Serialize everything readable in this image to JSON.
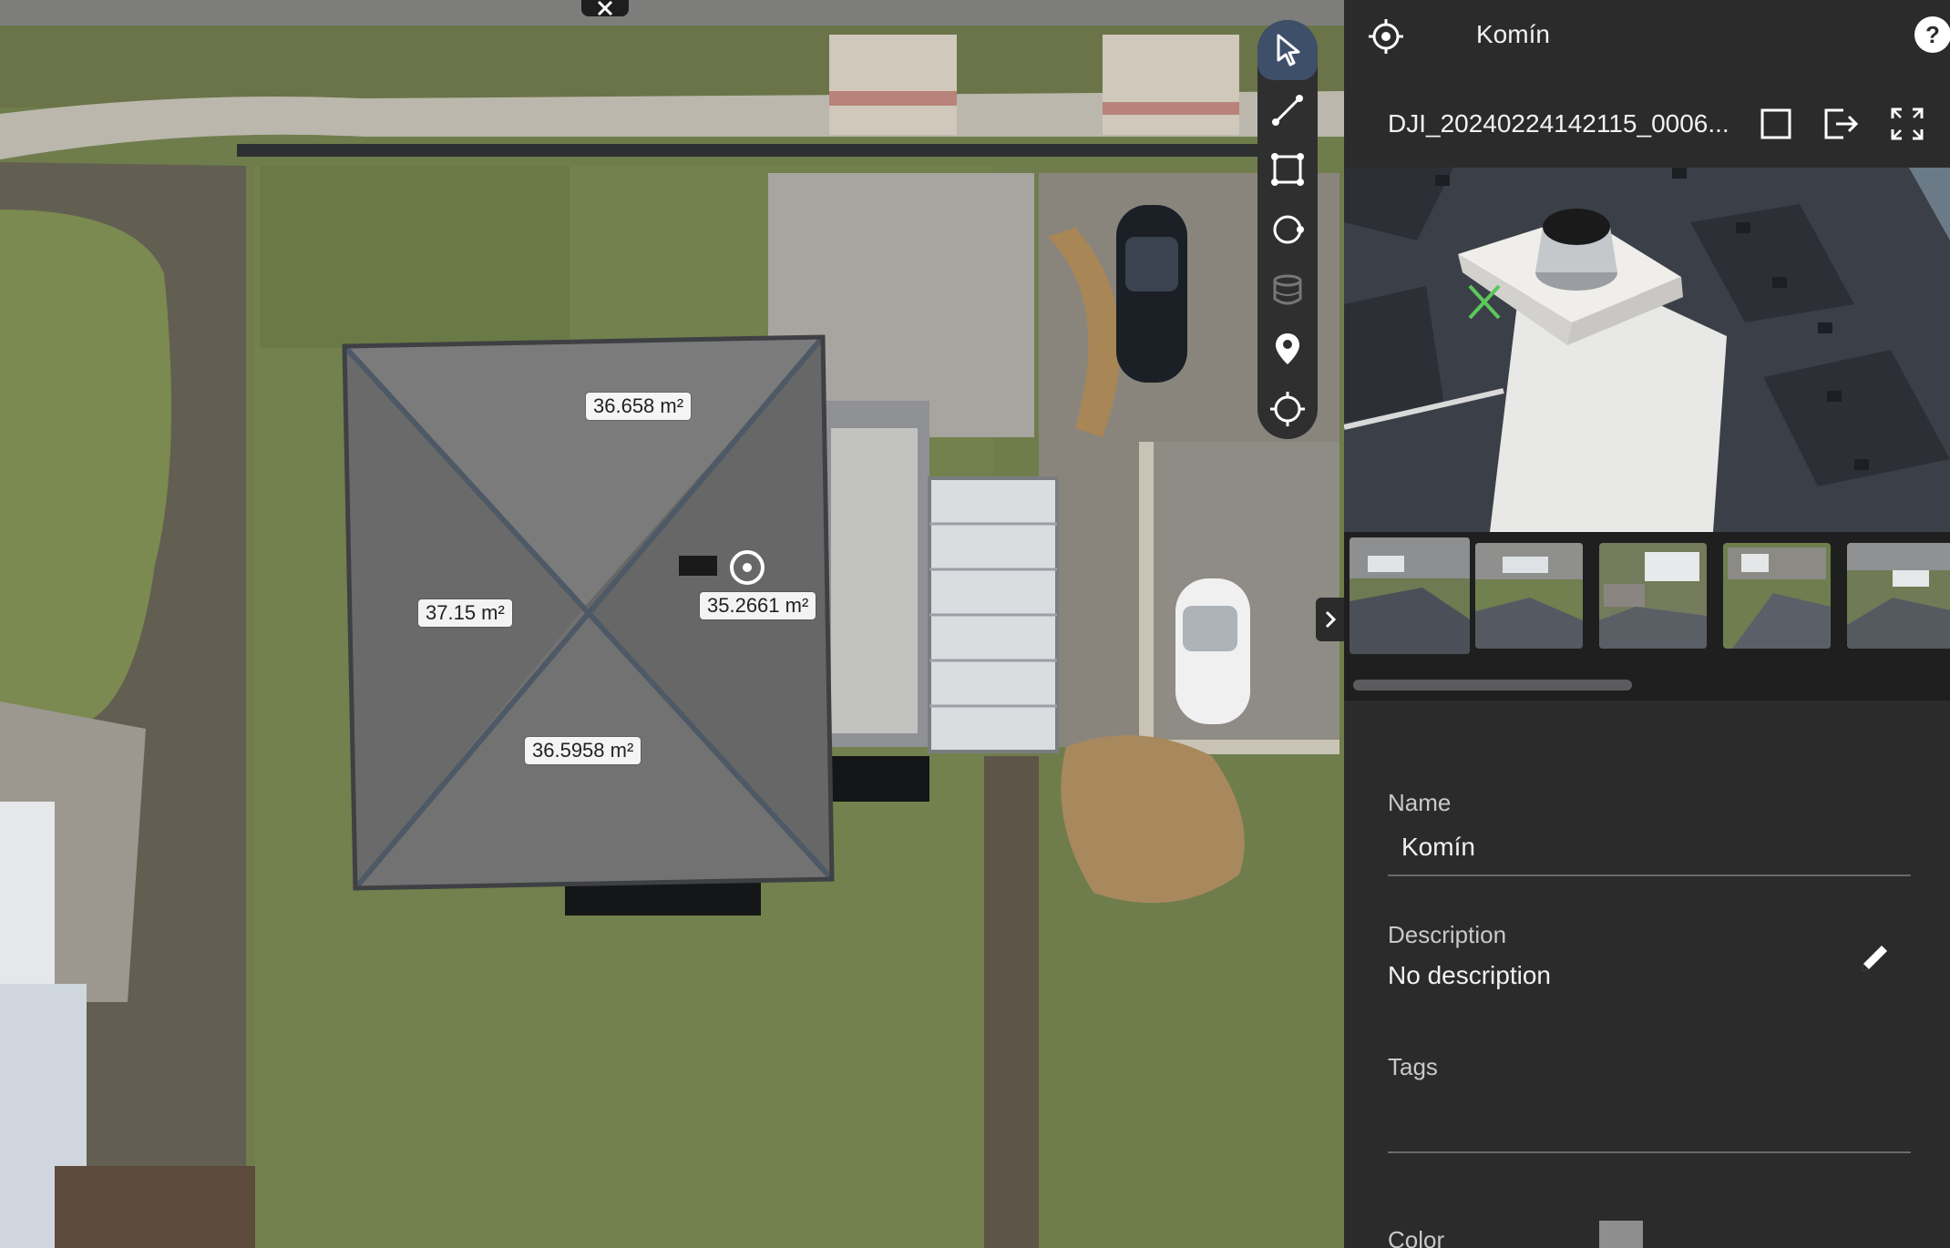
{
  "map": {
    "area_labels": [
      {
        "text": "36.658 m²"
      },
      {
        "text": "37.15 m²"
      },
      {
        "text": "35.2661 m²"
      },
      {
        "text": "36.5958 m²"
      }
    ]
  },
  "toolbar": {
    "tools": [
      {
        "name": "select-tool",
        "icon": "cursor-arrow-icon",
        "active": true
      },
      {
        "name": "line-measure-tool",
        "icon": "line-icon"
      },
      {
        "name": "area-measure-tool",
        "icon": "polygon-icon"
      },
      {
        "name": "circle-tool",
        "icon": "circle-icon"
      },
      {
        "name": "volume-tool",
        "icon": "cylinder-icon",
        "disabled": true
      },
      {
        "name": "pin-tool",
        "icon": "location-pin-icon"
      },
      {
        "name": "point-tool",
        "icon": "crosshair-icon"
      }
    ]
  },
  "panel": {
    "title": "Komín",
    "header_icon": "crosshair-icon",
    "help_icon": "help-icon",
    "image_filename": "DJI_20240224142115_0006...",
    "image_actions": [
      "square-icon",
      "export-icon",
      "fullscreen-icon"
    ],
    "fields": {
      "name_label": "Name",
      "name_value": "Komín",
      "description_label": "Description",
      "description_value": "No description",
      "tags_label": "Tags",
      "tags_value": "",
      "color_label": "Color",
      "color_value": "#8e8e8e"
    }
  },
  "colors": {
    "accent_active": "#3e4f6a",
    "panel_bg": "#2b2b2c",
    "marker_green": "#5cc85c"
  }
}
